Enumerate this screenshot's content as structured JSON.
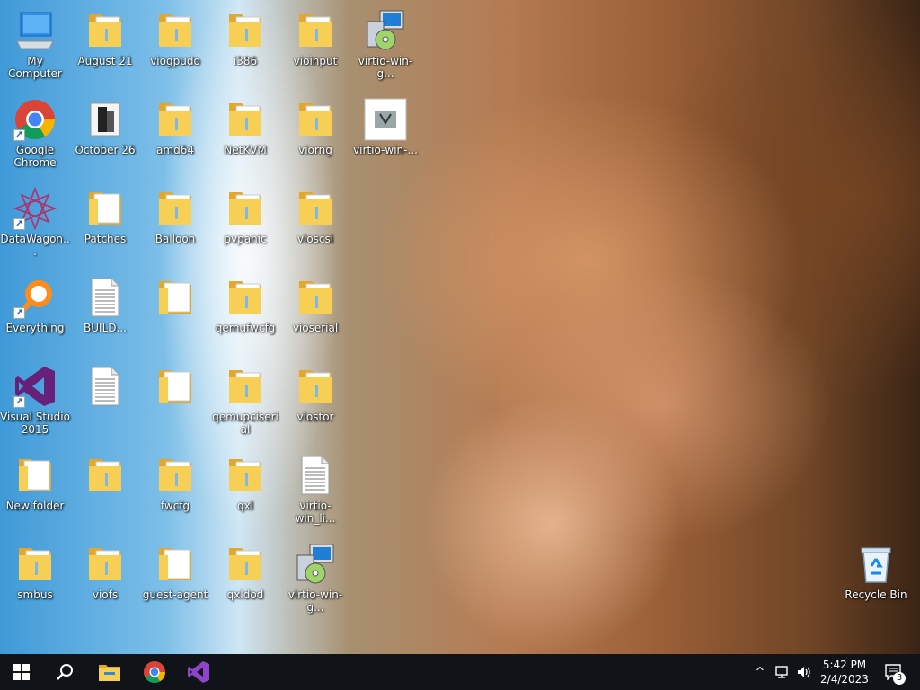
{
  "desktop": {
    "icons": [
      {
        "id": "my-computer",
        "label": "My Computer",
        "type": "computer",
        "col": 0,
        "row": 0
      },
      {
        "id": "august-21",
        "label": "August 21",
        "type": "folder",
        "col": 1,
        "row": 0
      },
      {
        "id": "viogpudo",
        "label": "viogpudo",
        "type": "folder",
        "col": 2,
        "row": 0
      },
      {
        "id": "i386",
        "label": "i386",
        "type": "folder",
        "col": 3,
        "row": 0
      },
      {
        "id": "vioinput",
        "label": "vioinput",
        "type": "folder",
        "col": 4,
        "row": 0
      },
      {
        "id": "virtio-win-gt-1",
        "label": "virtio-win-g...",
        "type": "installer",
        "col": 5,
        "row": 0
      },
      {
        "id": "google-chrome",
        "label": "Google Chrome",
        "type": "chrome",
        "col": 0,
        "row": 1,
        "shortcut": true
      },
      {
        "id": "october-26",
        "label": "October 26",
        "type": "dark-folder",
        "col": 1,
        "row": 1
      },
      {
        "id": "amd64",
        "label": "amd64",
        "type": "folder",
        "col": 2,
        "row": 1
      },
      {
        "id": "netkvm",
        "label": "NetKVM",
        "type": "folder",
        "col": 3,
        "row": 1
      },
      {
        "id": "viorng",
        "label": "viorng",
        "type": "folder",
        "col": 4,
        "row": 1
      },
      {
        "id": "virtio-win-2",
        "label": "virtio-win-...",
        "type": "image-file",
        "col": 5,
        "row": 1
      },
      {
        "id": "datawagon",
        "label": "DataWagon...",
        "type": "datawagon",
        "col": 0,
        "row": 2,
        "shortcut": true
      },
      {
        "id": "patches",
        "label": "Patches",
        "type": "folder-white",
        "col": 1,
        "row": 2
      },
      {
        "id": "balloon",
        "label": "Balloon",
        "type": "folder",
        "col": 2,
        "row": 2
      },
      {
        "id": "pvpanic",
        "label": "pvpanic",
        "type": "folder",
        "col": 3,
        "row": 2
      },
      {
        "id": "vioscsi",
        "label": "vioscsi",
        "type": "folder",
        "col": 4,
        "row": 2
      },
      {
        "id": "everything",
        "label": "Everything",
        "type": "everything",
        "col": 0,
        "row": 3,
        "shortcut": true
      },
      {
        "id": "build",
        "label": "BUILD...",
        "type": "document",
        "col": 1,
        "row": 3
      },
      {
        "id": "folder-r3c2",
        "label": "",
        "type": "folder-white",
        "col": 2,
        "row": 3
      },
      {
        "id": "qemufwcfg",
        "label": "qemufwcfg",
        "type": "folder",
        "col": 3,
        "row": 3
      },
      {
        "id": "vioserial",
        "label": "vioserial",
        "type": "folder",
        "col": 4,
        "row": 3
      },
      {
        "id": "visual-studio-2015",
        "label": "Visual Studio 2015",
        "type": "vs",
        "col": 0,
        "row": 4,
        "shortcut": true
      },
      {
        "id": "doc-r4c1",
        "label": "",
        "type": "document",
        "col": 1,
        "row": 4
      },
      {
        "id": "folder-r4c2",
        "label": "",
        "type": "folder-white",
        "col": 2,
        "row": 4
      },
      {
        "id": "qemupciserial",
        "label": "qemupciserial",
        "type": "folder",
        "col": 3,
        "row": 4
      },
      {
        "id": "viostor",
        "label": "viostor",
        "type": "folder",
        "col": 4,
        "row": 4
      },
      {
        "id": "new-folder",
        "label": "New folder",
        "type": "folder-white",
        "col": 0,
        "row": 5
      },
      {
        "id": "folder-r5c1",
        "label": "",
        "type": "folder",
        "col": 1,
        "row": 5
      },
      {
        "id": "fwcfg",
        "label": "fwcfg",
        "type": "folder",
        "col": 2,
        "row": 5
      },
      {
        "id": "qxl",
        "label": "qxl",
        "type": "folder",
        "col": 3,
        "row": 5
      },
      {
        "id": "virtio-win-li",
        "label": "virtio-win_li...",
        "type": "document",
        "col": 4,
        "row": 5
      },
      {
        "id": "smbus",
        "label": "smbus",
        "type": "folder",
        "col": 0,
        "row": 6
      },
      {
        "id": "viofs",
        "label": "viofs",
        "type": "folder",
        "col": 1,
        "row": 6
      },
      {
        "id": "guest-agent",
        "label": "guest-agent",
        "type": "folder-white",
        "col": 2,
        "row": 6
      },
      {
        "id": "qxldod",
        "label": "qxldod",
        "type": "folder",
        "col": 3,
        "row": 6
      },
      {
        "id": "virtio-win-gt-2",
        "label": "virtio-win-g...",
        "type": "installer",
        "col": 4,
        "row": 6
      }
    ],
    "recycle_bin": {
      "label": "Recycle Bin"
    }
  },
  "taskbar": {
    "start_icon": "windows-logo-icon",
    "search_icon": "search-icon",
    "pinned": [
      {
        "id": "file-explorer",
        "icon": "file-explorer-icon"
      },
      {
        "id": "chrome",
        "icon": "chrome-icon"
      },
      {
        "id": "visual-studio",
        "icon": "visual-studio-icon"
      }
    ],
    "tray": {
      "chevron": "^"
    },
    "clock": {
      "time": "5:42 PM",
      "date": "2/4/2023"
    },
    "notifications": {
      "count": "3"
    }
  },
  "colors": {
    "folder": "#f7cf55",
    "folder_dark": "#e2a82b",
    "taskbar": "#101418",
    "vs_purple": "#68217a",
    "chrome_red": "#db4437",
    "chrome_green": "#0f9d58",
    "chrome_yellow": "#f4b400",
    "chrome_blue": "#4285f4"
  }
}
